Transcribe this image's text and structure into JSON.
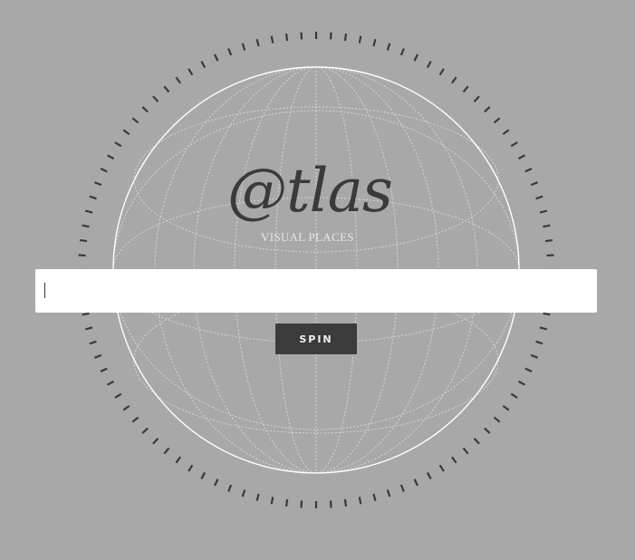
{
  "brand": {
    "logo_text": "@tlas",
    "tagline": "VISUAL PLACES"
  },
  "search": {
    "value": "",
    "placeholder": ""
  },
  "actions": {
    "spin_label": "SPIN"
  },
  "icons": {
    "globe": "globe-wireframe-icon",
    "dial": "tick-ring-icon"
  },
  "colors": {
    "background": "#a8a8a8",
    "ink": "#3a3a3a",
    "globe_line": "#ffffff",
    "button": "#3b3b3b"
  }
}
